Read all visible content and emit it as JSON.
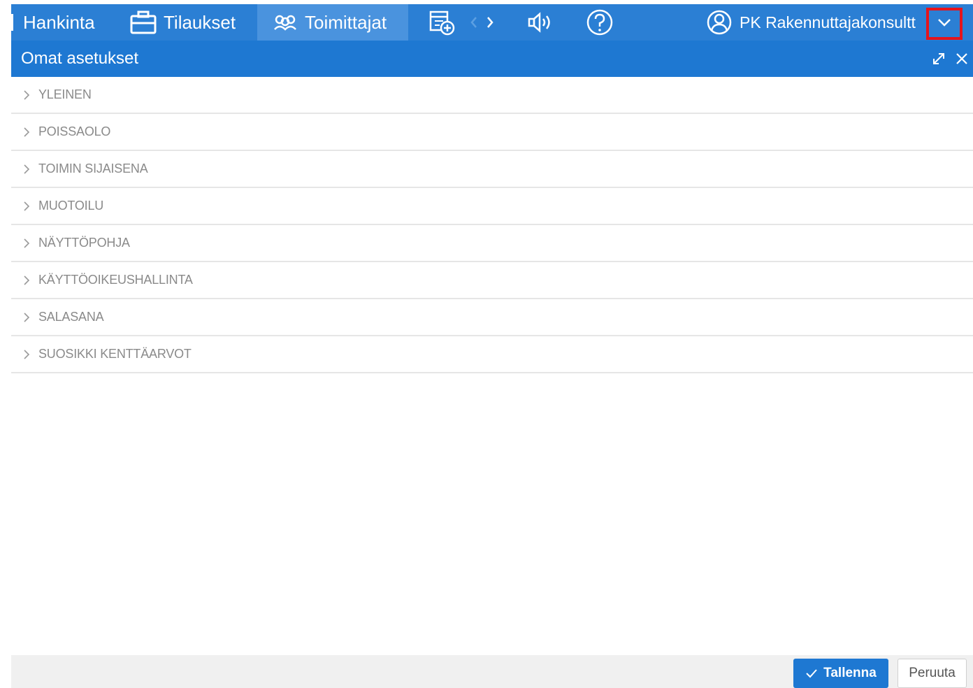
{
  "nav": {
    "items": [
      {
        "label": "Hankinta",
        "icon": "divider-mark"
      },
      {
        "label": "Tilaukset",
        "icon": "briefcase-icon"
      },
      {
        "label": "Toimittajat",
        "icon": "users-icon",
        "active": true
      }
    ],
    "icons": [
      "calendar-add-icon",
      "chevron-left-icon",
      "chevron-right-icon",
      "speaker-icon",
      "help-icon"
    ],
    "user": {
      "name": "PK Rakennuttajakonsultt",
      "icon": "user-circle-icon",
      "dropdown_icon": "chevron-down-icon"
    }
  },
  "panel": {
    "title": "Omat asetukset",
    "icons": [
      "expand-icon",
      "close-icon"
    ]
  },
  "sections": [
    "YLEINEN",
    "POISSAOLO",
    "TOIMIN SIJAISENA",
    "MUOTOILU",
    "NÄYTTÖPOHJA",
    "KÄYTTÖOIKEUSHALLINTA",
    "SALASANA",
    "SUOSIKKI KENTTÄARVOT"
  ],
  "footer": {
    "save_label": "Tallenna",
    "cancel_label": "Peruuta"
  },
  "colors": {
    "nav_bg": "#2b7fd4",
    "header_bg": "#1e78d2",
    "highlight": "#e5141c"
  }
}
